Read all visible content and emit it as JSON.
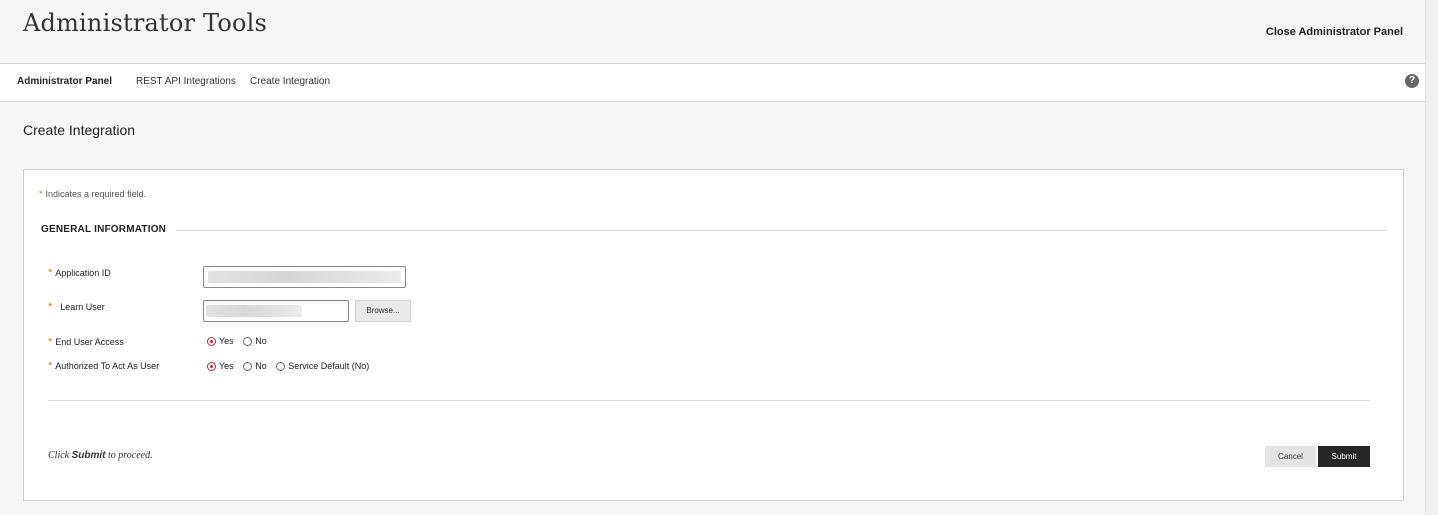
{
  "header": {
    "title": "Administrator Tools",
    "close_label": "Close Administrator Panel"
  },
  "breadcrumb": {
    "items": [
      "Administrator Panel",
      "REST API Integrations",
      "Create Integration"
    ],
    "help_icon": "?"
  },
  "page": {
    "title": "Create Integration"
  },
  "form": {
    "required_note": "Indicates a required field.",
    "required_symbol": "*",
    "section_title": "GENERAL INFORMATION",
    "fields": {
      "application_id": {
        "label": "Application ID",
        "value": ""
      },
      "learn_user": {
        "label": "Learn User",
        "value": "",
        "browse_label": "Browse..."
      },
      "end_user_access": {
        "label": "End User Access",
        "options": [
          "Yes",
          "No"
        ],
        "selected": "Yes"
      },
      "authorized": {
        "label": "Authorized To Act As User",
        "options": [
          "Yes",
          "No",
          "Service Default (No)"
        ],
        "selected": "Yes"
      }
    },
    "proceed_prefix": "Click ",
    "proceed_bold": "Submit",
    "proceed_suffix": " to proceed.",
    "cancel_label": "Cancel",
    "submit_label": "Submit"
  },
  "colors": {
    "required_star": "#d97b1c",
    "radio_checked": "#c0283c",
    "submit_bg": "#262626"
  }
}
